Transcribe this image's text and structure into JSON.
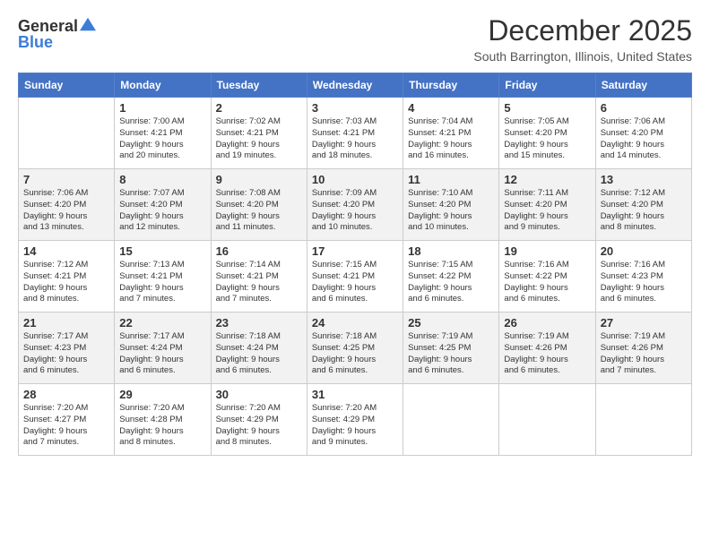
{
  "header": {
    "logo_general": "General",
    "logo_blue": "Blue",
    "month": "December 2025",
    "location": "South Barrington, Illinois, United States"
  },
  "days_of_week": [
    "Sunday",
    "Monday",
    "Tuesday",
    "Wednesday",
    "Thursday",
    "Friday",
    "Saturday"
  ],
  "weeks": [
    [
      {
        "day": "",
        "info": ""
      },
      {
        "day": "1",
        "info": "Sunrise: 7:00 AM\nSunset: 4:21 PM\nDaylight: 9 hours\nand 20 minutes."
      },
      {
        "day": "2",
        "info": "Sunrise: 7:02 AM\nSunset: 4:21 PM\nDaylight: 9 hours\nand 19 minutes."
      },
      {
        "day": "3",
        "info": "Sunrise: 7:03 AM\nSunset: 4:21 PM\nDaylight: 9 hours\nand 18 minutes."
      },
      {
        "day": "4",
        "info": "Sunrise: 7:04 AM\nSunset: 4:21 PM\nDaylight: 9 hours\nand 16 minutes."
      },
      {
        "day": "5",
        "info": "Sunrise: 7:05 AM\nSunset: 4:20 PM\nDaylight: 9 hours\nand 15 minutes."
      },
      {
        "day": "6",
        "info": "Sunrise: 7:06 AM\nSunset: 4:20 PM\nDaylight: 9 hours\nand 14 minutes."
      }
    ],
    [
      {
        "day": "7",
        "info": "Sunrise: 7:06 AM\nSunset: 4:20 PM\nDaylight: 9 hours\nand 13 minutes."
      },
      {
        "day": "8",
        "info": "Sunrise: 7:07 AM\nSunset: 4:20 PM\nDaylight: 9 hours\nand 12 minutes."
      },
      {
        "day": "9",
        "info": "Sunrise: 7:08 AM\nSunset: 4:20 PM\nDaylight: 9 hours\nand 11 minutes."
      },
      {
        "day": "10",
        "info": "Sunrise: 7:09 AM\nSunset: 4:20 PM\nDaylight: 9 hours\nand 10 minutes."
      },
      {
        "day": "11",
        "info": "Sunrise: 7:10 AM\nSunset: 4:20 PM\nDaylight: 9 hours\nand 10 minutes."
      },
      {
        "day": "12",
        "info": "Sunrise: 7:11 AM\nSunset: 4:20 PM\nDaylight: 9 hours\nand 9 minutes."
      },
      {
        "day": "13",
        "info": "Sunrise: 7:12 AM\nSunset: 4:20 PM\nDaylight: 9 hours\nand 8 minutes."
      }
    ],
    [
      {
        "day": "14",
        "info": "Sunrise: 7:12 AM\nSunset: 4:21 PM\nDaylight: 9 hours\nand 8 minutes."
      },
      {
        "day": "15",
        "info": "Sunrise: 7:13 AM\nSunset: 4:21 PM\nDaylight: 9 hours\nand 7 minutes."
      },
      {
        "day": "16",
        "info": "Sunrise: 7:14 AM\nSunset: 4:21 PM\nDaylight: 9 hours\nand 7 minutes."
      },
      {
        "day": "17",
        "info": "Sunrise: 7:15 AM\nSunset: 4:21 PM\nDaylight: 9 hours\nand 6 minutes."
      },
      {
        "day": "18",
        "info": "Sunrise: 7:15 AM\nSunset: 4:22 PM\nDaylight: 9 hours\nand 6 minutes."
      },
      {
        "day": "19",
        "info": "Sunrise: 7:16 AM\nSunset: 4:22 PM\nDaylight: 9 hours\nand 6 minutes."
      },
      {
        "day": "20",
        "info": "Sunrise: 7:16 AM\nSunset: 4:23 PM\nDaylight: 9 hours\nand 6 minutes."
      }
    ],
    [
      {
        "day": "21",
        "info": "Sunrise: 7:17 AM\nSunset: 4:23 PM\nDaylight: 9 hours\nand 6 minutes."
      },
      {
        "day": "22",
        "info": "Sunrise: 7:17 AM\nSunset: 4:24 PM\nDaylight: 9 hours\nand 6 minutes."
      },
      {
        "day": "23",
        "info": "Sunrise: 7:18 AM\nSunset: 4:24 PM\nDaylight: 9 hours\nand 6 minutes."
      },
      {
        "day": "24",
        "info": "Sunrise: 7:18 AM\nSunset: 4:25 PM\nDaylight: 9 hours\nand 6 minutes."
      },
      {
        "day": "25",
        "info": "Sunrise: 7:19 AM\nSunset: 4:25 PM\nDaylight: 9 hours\nand 6 minutes."
      },
      {
        "day": "26",
        "info": "Sunrise: 7:19 AM\nSunset: 4:26 PM\nDaylight: 9 hours\nand 6 minutes."
      },
      {
        "day": "27",
        "info": "Sunrise: 7:19 AM\nSunset: 4:26 PM\nDaylight: 9 hours\nand 7 minutes."
      }
    ],
    [
      {
        "day": "28",
        "info": "Sunrise: 7:20 AM\nSunset: 4:27 PM\nDaylight: 9 hours\nand 7 minutes."
      },
      {
        "day": "29",
        "info": "Sunrise: 7:20 AM\nSunset: 4:28 PM\nDaylight: 9 hours\nand 8 minutes."
      },
      {
        "day": "30",
        "info": "Sunrise: 7:20 AM\nSunset: 4:29 PM\nDaylight: 9 hours\nand 8 minutes."
      },
      {
        "day": "31",
        "info": "Sunrise: 7:20 AM\nSunset: 4:29 PM\nDaylight: 9 hours\nand 9 minutes."
      },
      {
        "day": "",
        "info": ""
      },
      {
        "day": "",
        "info": ""
      },
      {
        "day": "",
        "info": ""
      }
    ]
  ]
}
